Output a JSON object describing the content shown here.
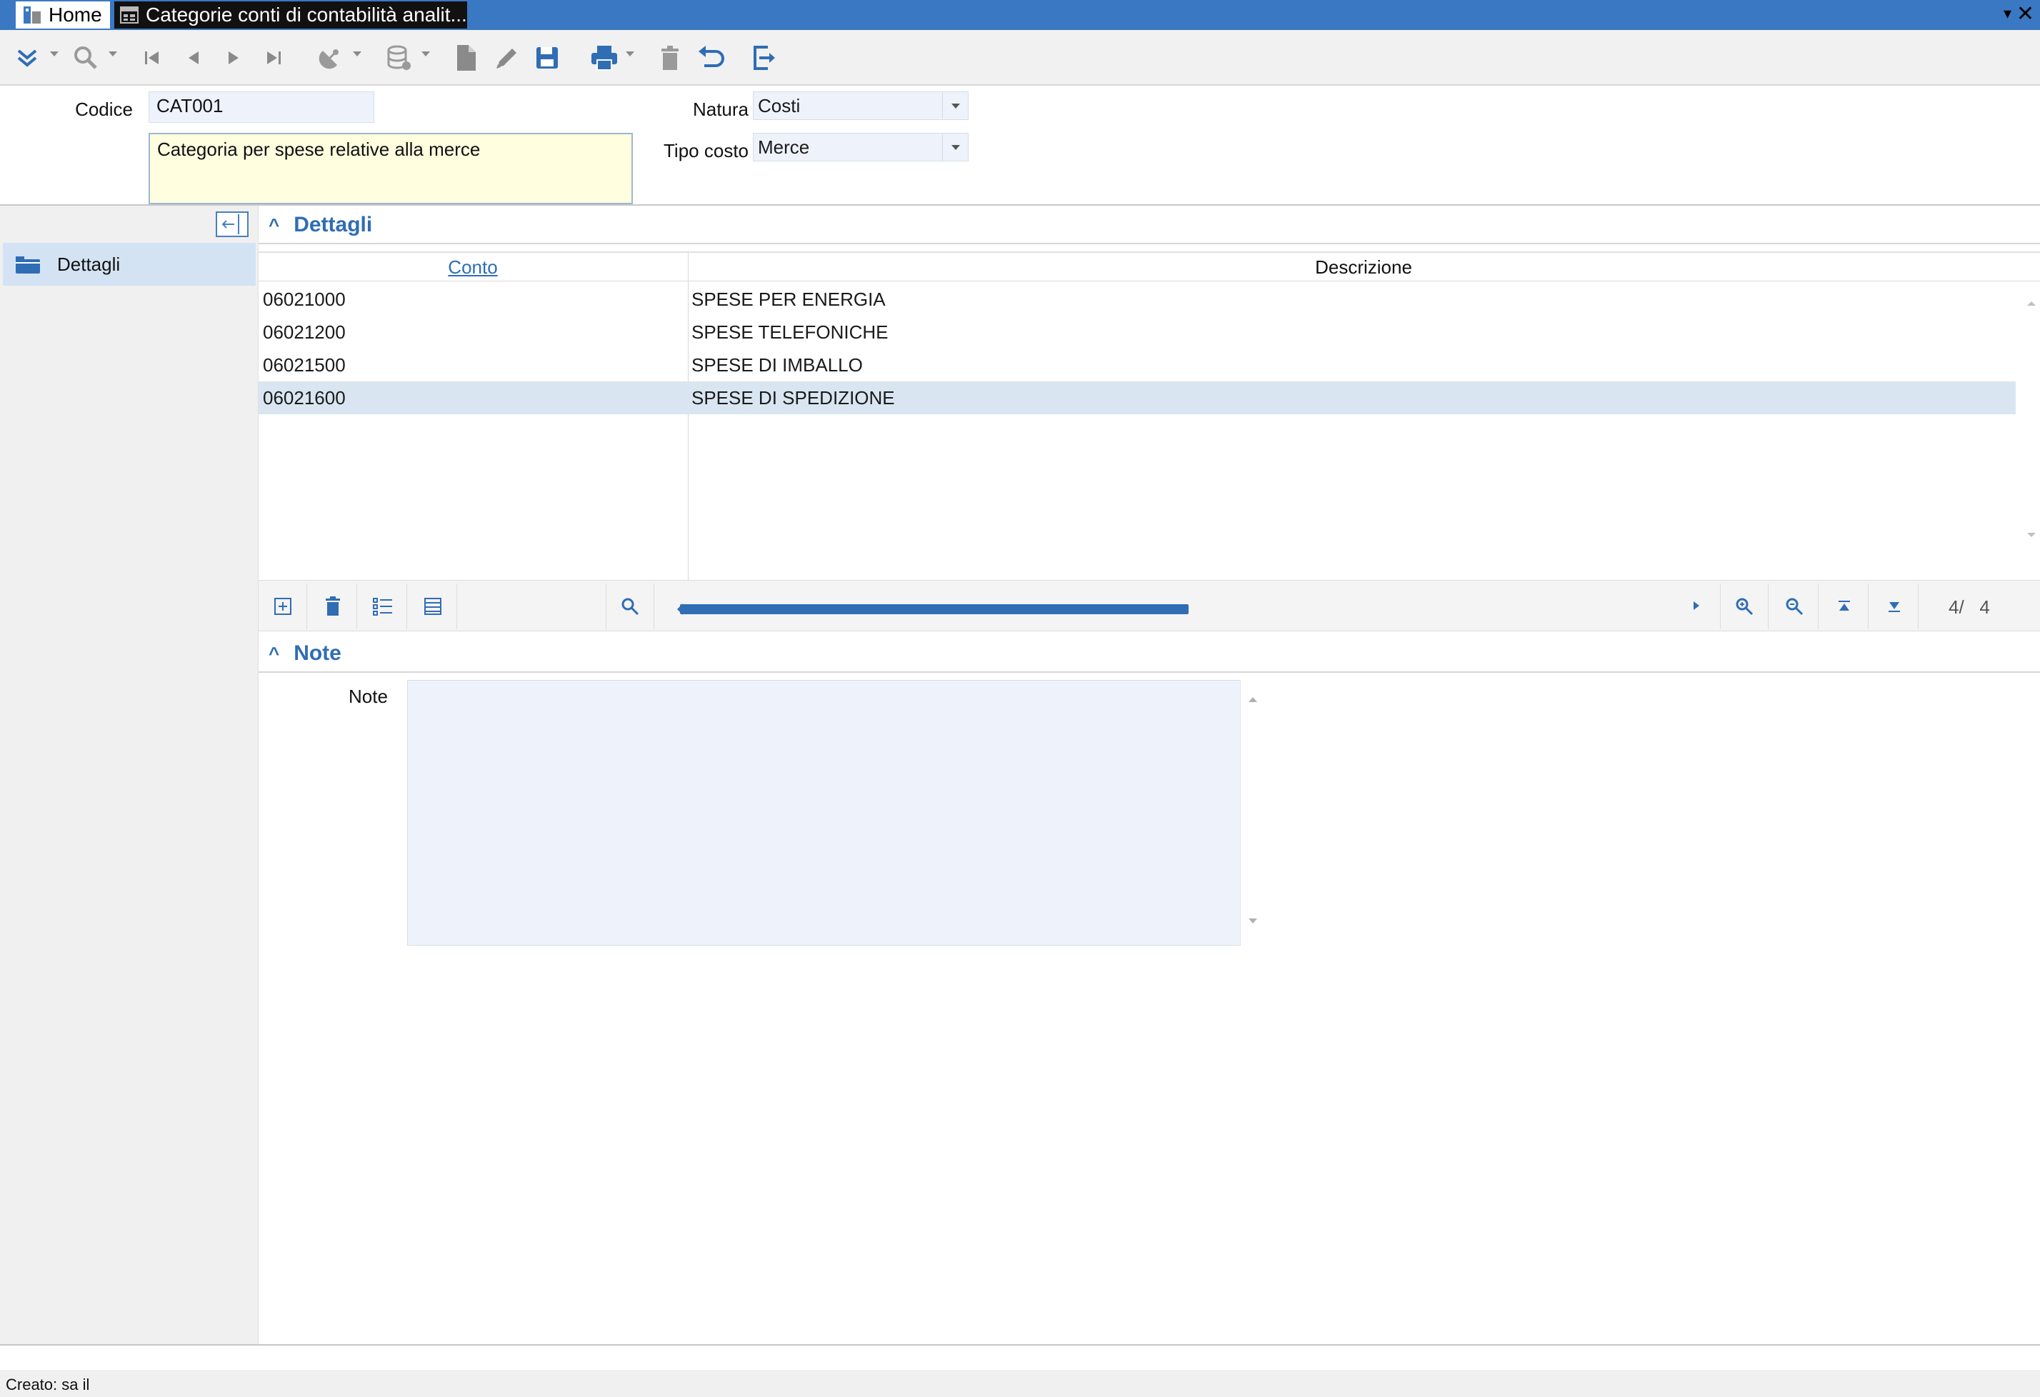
{
  "window": {
    "tabs": [
      {
        "label": "Home"
      },
      {
        "label": "Categorie conti di contabilità analit..."
      }
    ]
  },
  "toolbar": {
    "icons": [
      "collapse-all-icon",
      "search-icon",
      "first-record-icon",
      "previous-record-icon",
      "next-record-icon",
      "last-record-icon",
      "satellite-icon",
      "database-icon",
      "new-document-icon",
      "edit-icon",
      "save-icon",
      "print-icon",
      "delete-icon",
      "undo-icon",
      "exit-icon"
    ]
  },
  "form": {
    "codice_label": "Codice",
    "codice_value": "CAT001",
    "descrizione_value": "Categoria per spese relative alla merce",
    "natura_label": "Natura",
    "natura_value": "Costi",
    "tipo_costo_label": "Tipo costo",
    "tipo_costo_value": "Merce"
  },
  "leftnav": {
    "items": [
      {
        "label": "Dettagli"
      }
    ]
  },
  "sections": {
    "dettagli_title": "Dettagli",
    "note_title": "Note"
  },
  "grid": {
    "columns": [
      "Conto",
      "Descrizione"
    ],
    "rows": [
      {
        "conto": "06021000",
        "descrizione": "SPESE PER ENERGIA"
      },
      {
        "conto": "06021200",
        "descrizione": "SPESE TELEFONICHE"
      },
      {
        "conto": "06021500",
        "descrizione": "SPESE DI IMBALLO"
      },
      {
        "conto": "06021600",
        "descrizione": "SPESE DI SPEDIZIONE"
      }
    ],
    "selected_row": 3,
    "record_counter": "4/   4"
  },
  "note": {
    "label": "Note",
    "value": ""
  },
  "status": {
    "text": "Creato: sa il"
  },
  "colors": {
    "accent": "#2f6db5",
    "titlebar": "#3a78c3",
    "selected_row": "#d9e6f2",
    "description_bg": "#ffffe0"
  }
}
